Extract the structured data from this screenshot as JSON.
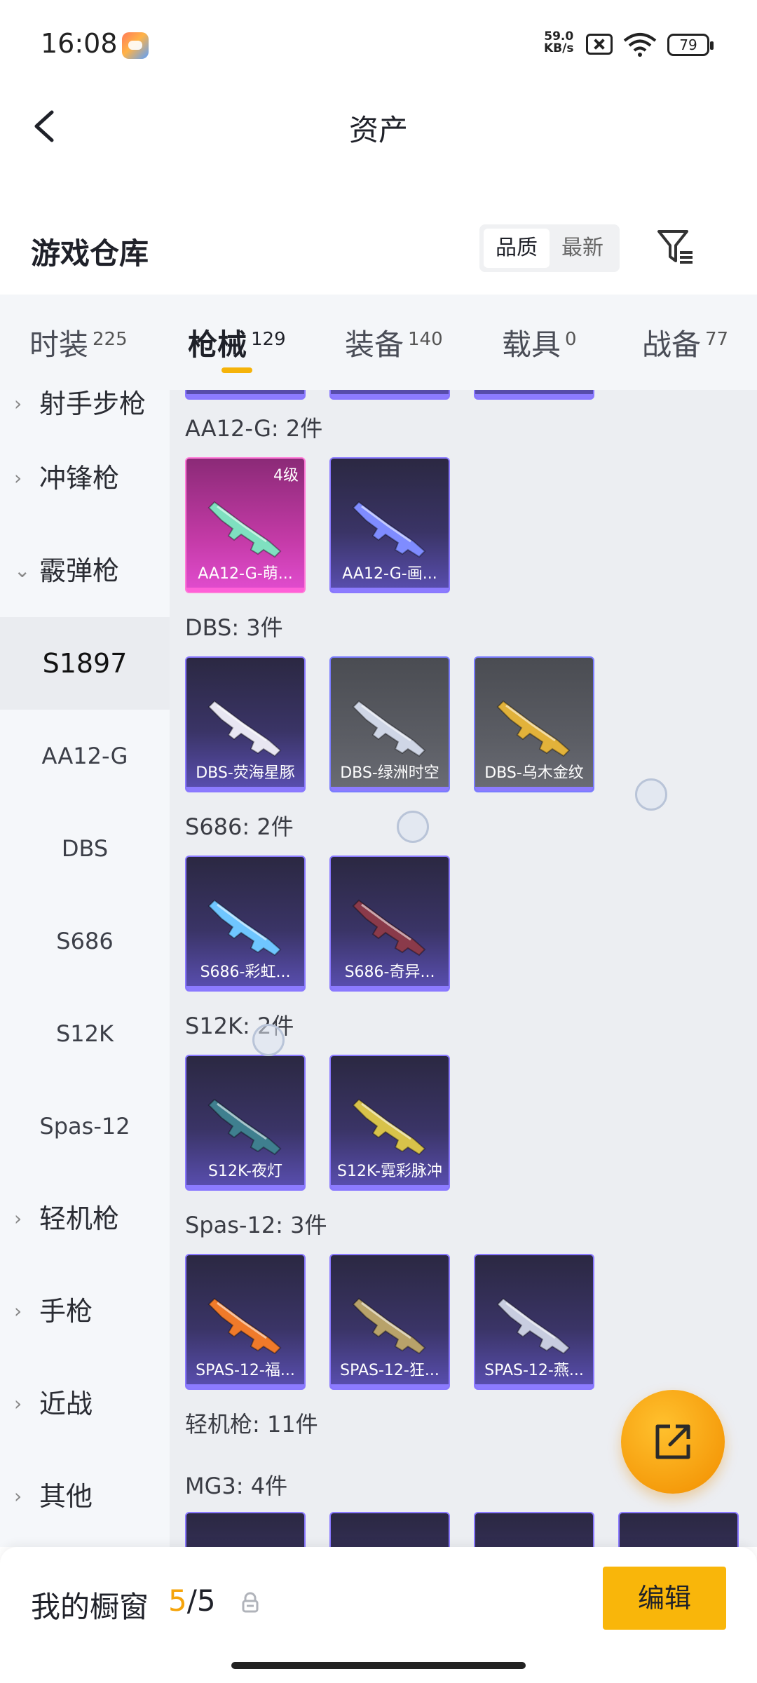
{
  "status_bar": {
    "time": "16:08",
    "net_speed_value": "59.0",
    "net_speed_unit": "KB/s",
    "battery": "79"
  },
  "header": {
    "title": "资产"
  },
  "warehouse": {
    "title": "游戏仓库",
    "sort_options": [
      "品质",
      "最新"
    ]
  },
  "tabs": [
    {
      "label": "时装",
      "count": "225"
    },
    {
      "label": "枪械",
      "count": "129"
    },
    {
      "label": "装备",
      "count": "140"
    },
    {
      "label": "载具",
      "count": "0"
    },
    {
      "label": "战备",
      "count": "77"
    }
  ],
  "sidebar": {
    "items": [
      {
        "label": "射手步枪",
        "type": "category"
      },
      {
        "label": "冲锋枪",
        "type": "category"
      },
      {
        "label": "霰弹枪",
        "type": "category",
        "expanded": true
      },
      {
        "label": "S1897",
        "type": "sub",
        "active": true
      },
      {
        "label": "AA12-G",
        "type": "sub"
      },
      {
        "label": "DBS",
        "type": "sub"
      },
      {
        "label": "S686",
        "type": "sub"
      },
      {
        "label": "S12K",
        "type": "sub"
      },
      {
        "label": "Spas-12",
        "type": "sub"
      },
      {
        "label": "轻机枪",
        "type": "category"
      },
      {
        "label": "手枪",
        "type": "category"
      },
      {
        "label": "近战",
        "type": "category"
      },
      {
        "label": "其他",
        "type": "category"
      }
    ]
  },
  "content": {
    "groups": [
      {
        "heading": "AA12-G: 2件",
        "items": [
          {
            "name": "AA12-G-萌...",
            "level": "4级",
            "style": "pink",
            "gun_color": "#7fe0c0"
          },
          {
            "name": "AA12-G-画...",
            "style": "purple",
            "gun_color": "#7f8cff"
          }
        ]
      },
      {
        "heading": "DBS: 3件",
        "items": [
          {
            "name": "DBS-荧海星豚",
            "style": "purple",
            "gun_color": "#e8e6f2"
          },
          {
            "name": "DBS-绿洲时空",
            "style": "grey",
            "gun_color": "#cfd6e6"
          },
          {
            "name": "DBS-乌木金纹",
            "style": "grey",
            "gun_color": "#e2b23a"
          }
        ]
      },
      {
        "heading": "S686: 2件",
        "items": [
          {
            "name": "S686-彩虹...",
            "style": "purple",
            "gun_color": "#6fc6ff"
          },
          {
            "name": "S686-奇异...",
            "style": "purple",
            "gun_color": "#8a3a4a"
          }
        ]
      },
      {
        "heading": "S12K: 2件",
        "items": [
          {
            "name": "S12K-夜灯",
            "style": "purple",
            "gun_color": "#3f7f8f"
          },
          {
            "name": "S12K-霓彩脉冲",
            "style": "purple",
            "gun_color": "#d8c24a"
          }
        ]
      },
      {
        "heading": "Spas-12: 3件",
        "items": [
          {
            "name": "SPAS-12-福...",
            "style": "purple",
            "gun_color": "#f07a2a"
          },
          {
            "name": "SPAS-12-狂...",
            "style": "purple",
            "gun_color": "#b8a26a"
          },
          {
            "name": "SPAS-12-燕...",
            "style": "purple",
            "gun_color": "#c8cde0"
          }
        ]
      }
    ],
    "section_heading": "轻机枪: 11件",
    "sub_heading": "MG3: 4件"
  },
  "bottom_bar": {
    "showcase_label": "我的橱窗",
    "showcase_used": "5",
    "showcase_total": "/5",
    "edit_label": "编辑"
  },
  "colors": {
    "accent": "#f9b60a",
    "purple_border": "#8a79ff",
    "pink_card": "#c33aa6"
  }
}
